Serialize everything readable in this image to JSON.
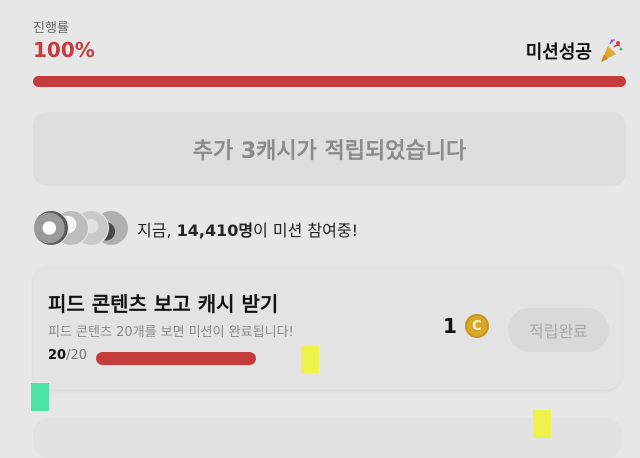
{
  "progress": {
    "label": "진행률",
    "value": "100%",
    "fraction": 1.0,
    "status": "미션성공",
    "status_icon": "party-popper-icon"
  },
  "banner": {
    "text": "추가 3캐시가 적립되었습니다"
  },
  "participants": {
    "prefix": "지금, ",
    "count": "14,410명",
    "suffix": "이 미션 참여중!"
  },
  "mission": {
    "title": "피드 콘텐츠 보고 캐시 받기",
    "subtitle": "피드 콘텐츠 20개를 보면 미션이 완료됩니다!",
    "current": "20",
    "total": "/20",
    "fraction": 1.0,
    "reward_amount": "1",
    "coin_symbol": "C",
    "claim_label": "적립완료"
  },
  "colors": {
    "accent": "#c43c3c",
    "marker_yellow": "#eef34c",
    "marker_green": "#4de3a4"
  }
}
